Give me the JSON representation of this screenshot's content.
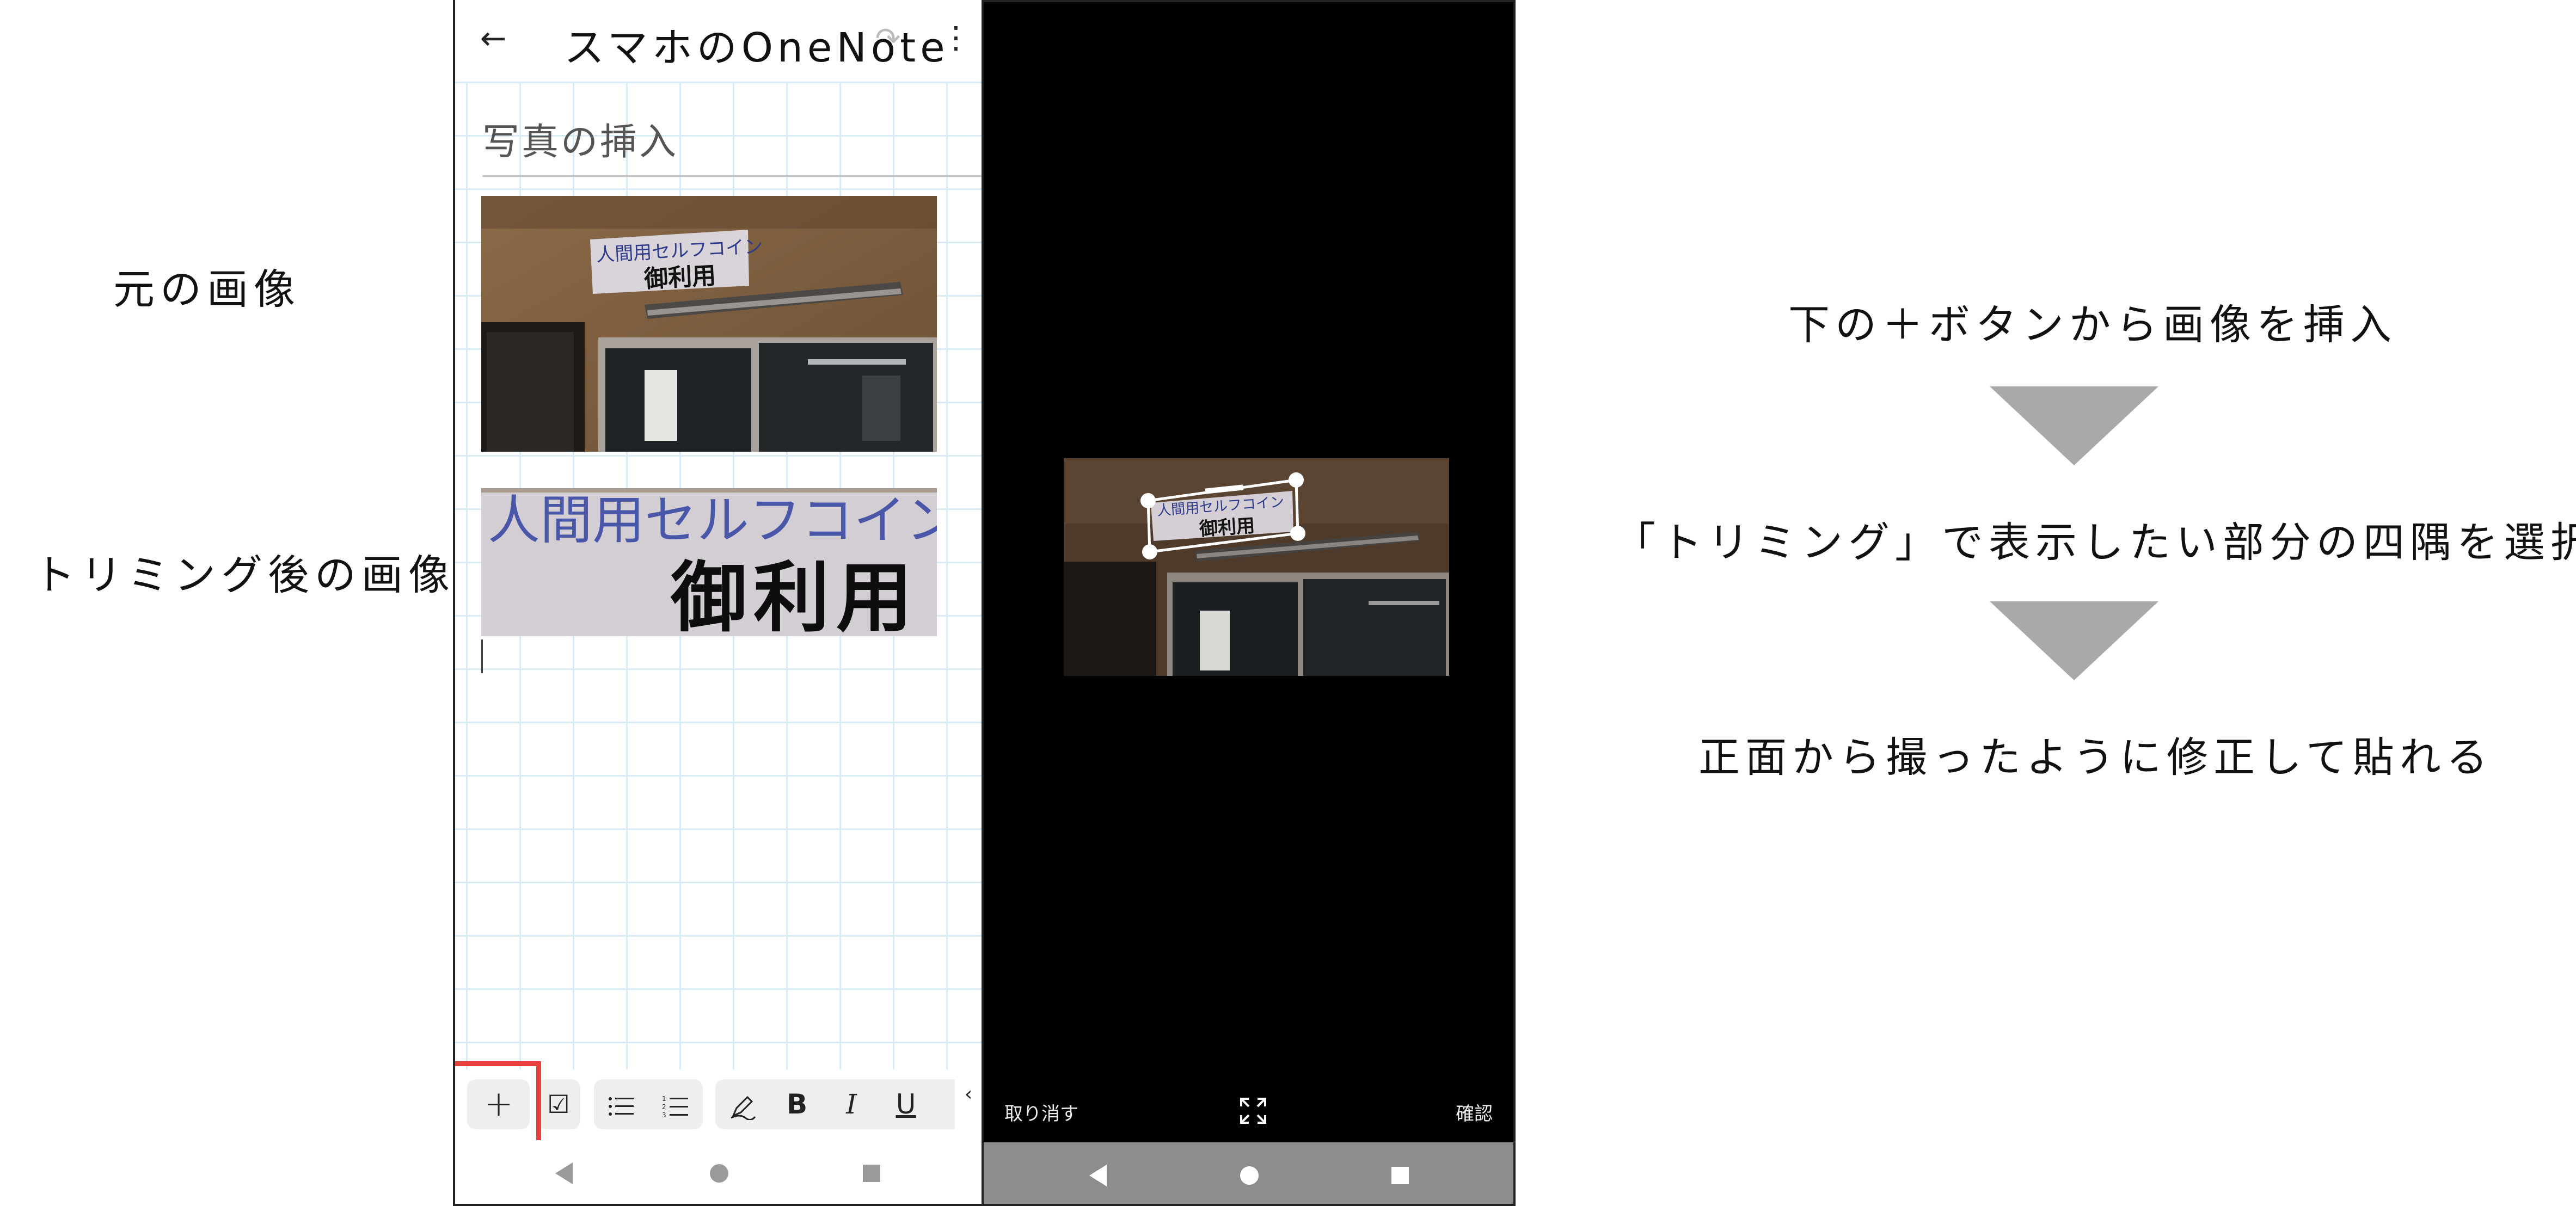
{
  "annotations_left": {
    "original_label": "元の画像",
    "cropped_label": "トリミング後の画像"
  },
  "phone1": {
    "app_title": "スマホのOneNote",
    "page_title": "写真の挿入",
    "photo_sign": {
      "line1": "人間用セルフコイン",
      "line2": "御利用"
    },
    "cropped_sign": {
      "line1": "人間用セルフコイン",
      "line2": "御利用"
    },
    "toolbar": {
      "plus": "+",
      "checkbox": "☑",
      "bold": "B",
      "italic": "I",
      "underline": "U"
    },
    "icons": {
      "back": "back-arrow-icon",
      "redo": "redo-icon",
      "more": "more-vertical-icon",
      "bullets": "bulleted-list-icon",
      "numbering": "numbered-list-icon",
      "pen": "pen-icon"
    },
    "highlight_color": "#e8403c"
  },
  "phone2": {
    "cancel": "取り消す",
    "confirm": "確認",
    "sign_line1": "人間用セルフコイン",
    "sign_line2": "御利用"
  },
  "steps": {
    "step1": "下の＋ボタンから画像を挿入",
    "step2": "「トリミング」で表示したい部分の四隅を選択",
    "step3": "正面から撮ったように修正して貼れる",
    "arrow_color": "#a9a9a9"
  }
}
